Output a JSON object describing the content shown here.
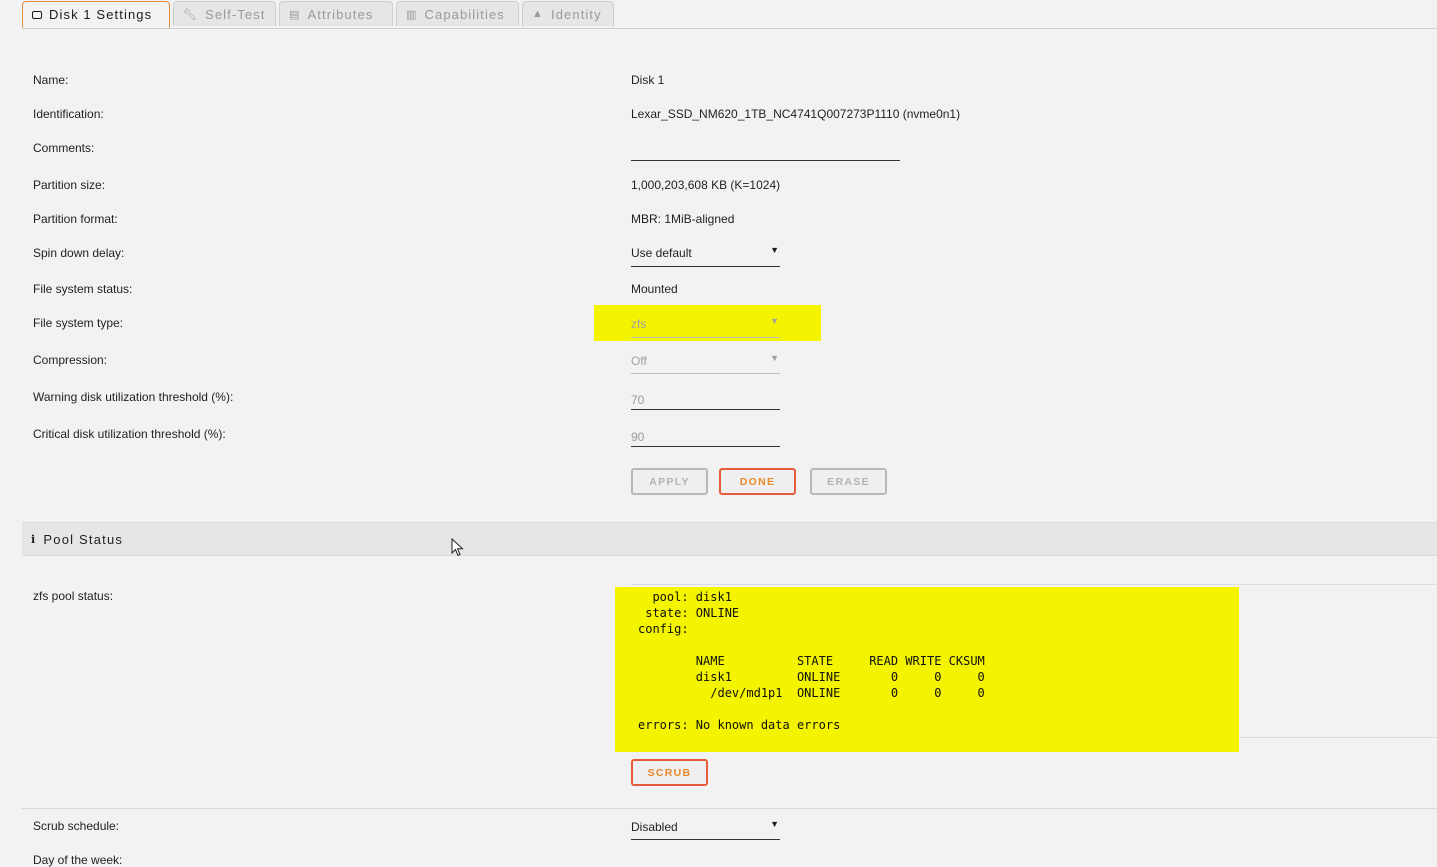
{
  "tabs": [
    {
      "label": "Disk 1 Settings",
      "icon": "drive-icon",
      "active": true
    },
    {
      "label": "Self-Test",
      "icon": "wrench-icon",
      "active": false
    },
    {
      "label": "Attributes",
      "icon": "id-card-icon",
      "active": false
    },
    {
      "label": "Capabilities",
      "icon": "building-icon",
      "active": false
    },
    {
      "label": "Identity",
      "icon": "user-icon",
      "active": false
    }
  ],
  "settings": {
    "name_label": "Name:",
    "name_value": "Disk 1",
    "identification_label": "Identification:",
    "identification_value": "Lexar_SSD_NM620_1TB_NC4741Q007273P1110 (nvme0n1)",
    "comments_label": "Comments:",
    "comments_value": "",
    "partition_size_label": "Partition size:",
    "partition_size_value": "1,000,203,608 KB (K=1024)",
    "partition_format_label": "Partition format:",
    "partition_format_value": "MBR: 1MiB-aligned",
    "spin_down_label": "Spin down delay:",
    "spin_down_value": "Use default",
    "fs_status_label": "File system status:",
    "fs_status_value": "Mounted",
    "fs_type_label": "File system type:",
    "fs_type_value": "zfs",
    "compression_label": "Compression:",
    "compression_value": "Off",
    "warning_label": "Warning disk utilization threshold (%):",
    "warning_value": "70",
    "critical_label": "Critical disk utilization threshold (%):",
    "critical_value": "90"
  },
  "buttons": {
    "apply": "APPLY",
    "done": "DONE",
    "erase": "ERASE",
    "scrub": "SCRUB"
  },
  "pool": {
    "header": "Pool Status",
    "status_label": "zfs pool status:",
    "status_text": "  pool: disk1\n state: ONLINE\nconfig:\n\n\tNAME          STATE     READ WRITE CKSUM\n\tdisk1         ONLINE       0     0     0\n\t  /dev/md1p1  ONLINE       0     0     0\n\nerrors: No known data errors",
    "scrub_schedule_label": "Scrub schedule:",
    "scrub_schedule_value": "Disabled",
    "cutoff_label": "Day of the week:"
  },
  "colors": {
    "highlight": "#f4f400",
    "accent_orange": "#e8892c",
    "button_red_border": "#e65c3b"
  }
}
